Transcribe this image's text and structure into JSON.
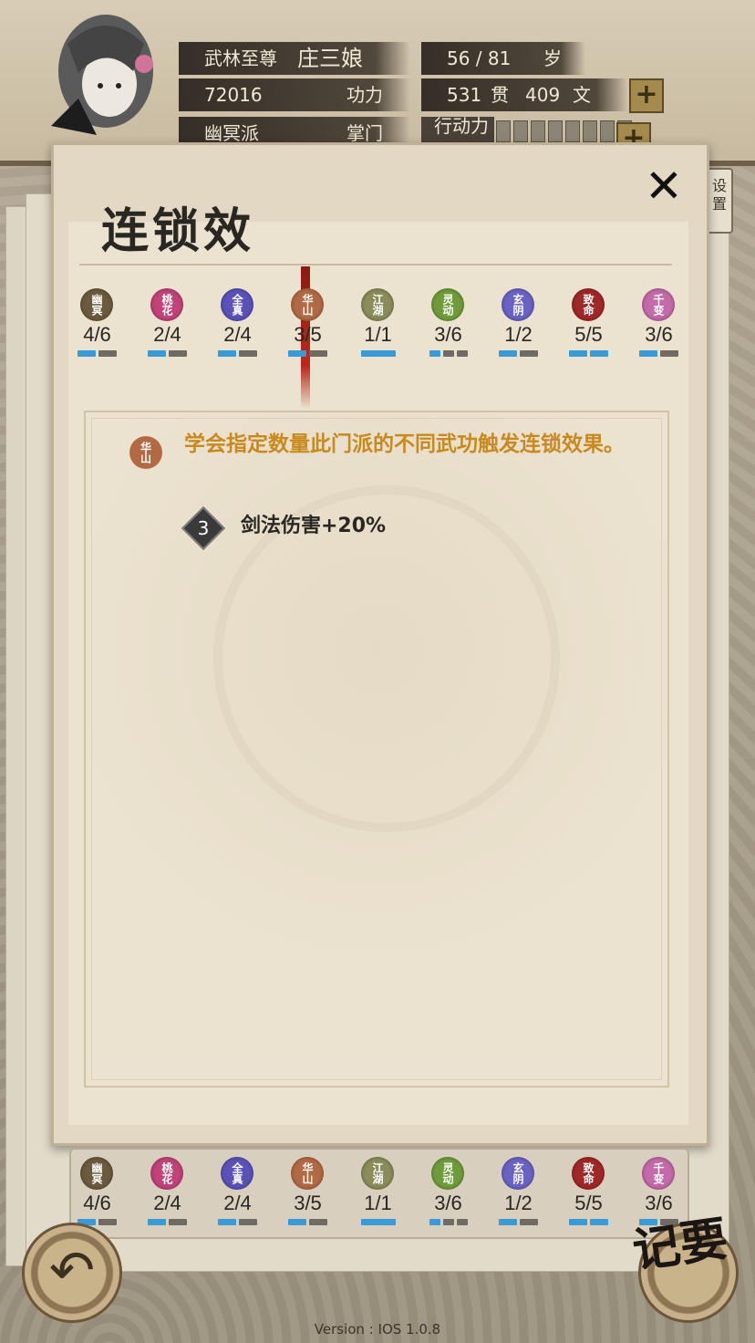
{
  "header": {
    "title_label": "武林至尊",
    "character_name": "庄三娘",
    "age": "56 / 81",
    "age_unit": "岁",
    "power_value": "72016",
    "power_label": "功力",
    "money_guan": "531",
    "money_guan_unit": "贯",
    "money_wen": "409",
    "money_wen_unit": "文",
    "sect_name": "幽冥派",
    "role": "掌门",
    "action_label": "行动力"
  },
  "panel": {
    "title": "连锁效",
    "close_icon": "close-icon",
    "settings_tab": "设置"
  },
  "sects": [
    {
      "badge": "幽冥",
      "count": "4/6",
      "color": "#6b5a3e",
      "filled": 1,
      "total": 2
    },
    {
      "badge": "桃花",
      "count": "2/4",
      "color": "#c2427a",
      "filled": 1,
      "total": 2
    },
    {
      "badge": "全真",
      "count": "2/4",
      "color": "#5a52b8",
      "filled": 1,
      "total": 2
    },
    {
      "badge": "华山",
      "count": "3/5",
      "color": "#b26a44",
      "filled": 1,
      "total": 2
    },
    {
      "badge": "江湖",
      "count": "1/1",
      "color": "#8a8c5a",
      "filled": 1,
      "total": 1
    },
    {
      "badge": "灵动",
      "count": "3/6",
      "color": "#6f9c3a",
      "filled": 1,
      "total": 3
    },
    {
      "badge": "玄阴",
      "count": "1/2",
      "color": "#6a63c4",
      "filled": 1,
      "total": 2
    },
    {
      "badge": "致命",
      "count": "5/5",
      "color": "#a02828",
      "filled": 2,
      "total": 2
    },
    {
      "badge": "千变",
      "count": "3/6",
      "color": "#c46aa8",
      "filled": 1,
      "total": 2
    }
  ],
  "selected_sect": {
    "badge": "华山",
    "description": "学会指定数量此门派的不同武功触发连锁效果。",
    "effect_level": "3",
    "effect_text": "剑法伤害+20%"
  },
  "bottom": {
    "back_icon": "back-arrow-icon",
    "notes_label": "记要",
    "version": "Version : IOS 1.0.8"
  },
  "colors": {
    "bar_filled": "#3a9ad6",
    "bar_empty": "#6f6a62",
    "desc_text": "#c88a1e"
  }
}
